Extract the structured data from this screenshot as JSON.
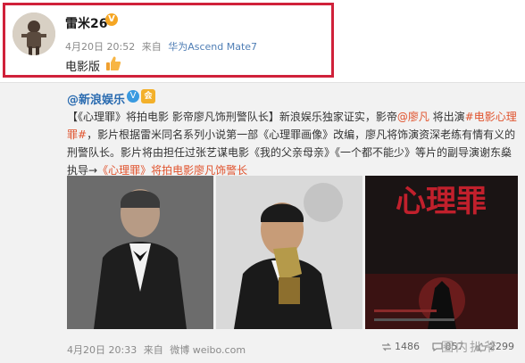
{
  "post": {
    "username": "雷米26",
    "vip_badge": "V",
    "time": "4月20日 20:52",
    "via": "来自",
    "device": "华为Ascend Mate7",
    "text": "电影版"
  },
  "repost": {
    "source": "@新浪娱乐",
    "verified_badge": "V",
    "rank_badge": "会",
    "body": {
      "p1": "【《心理罪》将拍电影 影帝廖凡饰刑警队长】新浪娱乐独家证实，影帝",
      "mention": "@廖凡",
      "p2": " 将出演",
      "topic": "#电影心理罪#",
      "p3": "，影片根据雷米同名系列小说第一部《心理罪画像》改编，廖凡将饰演资深老练有情有义的刑警队长。影片将由担任过张艺谋电影《我的父亲母亲》《一个都不能少》等片的副导演谢东燊执导→",
      "link": "《心理罪》将拍电影廖凡饰警长"
    },
    "time": "4月20日 20:33",
    "via": "来自",
    "app": "微博 weibo.com",
    "stats": {
      "reposts": "1486",
      "comments": "857",
      "likes": "2299"
    },
    "poster_title": "心理罪"
  },
  "watermark": "圈内扒爷",
  "colors": {
    "highlight": "#d0213a",
    "link": "#e0522c",
    "name": "#2a6bb0"
  }
}
